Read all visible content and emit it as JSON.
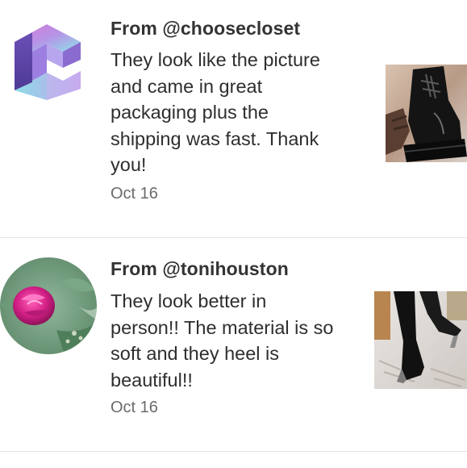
{
  "reviews": [
    {
      "from": "From @choosecloset",
      "text": "They look like the picture\nand came in great\npackaging plus the\nshipping was fast. Thank\nyou!",
      "date": "Oct 16",
      "avatar": "choosecloset-c-logo",
      "thumbnail": "black-combat-boots-photo"
    },
    {
      "from": "From @tonihouston",
      "text": "They look better in\nperson!! The material is so\nsoft and they heel is\nbeautiful!!",
      "date": "Oct 16",
      "avatar": "pink-flower-photo",
      "thumbnail": "black-knee-high-heeled-boots-photo"
    }
  ],
  "colors": {
    "name_text": "#333333",
    "body_text": "#2e2e2e",
    "date_text": "#6b6b6b",
    "divider": "#e4e4e4"
  }
}
